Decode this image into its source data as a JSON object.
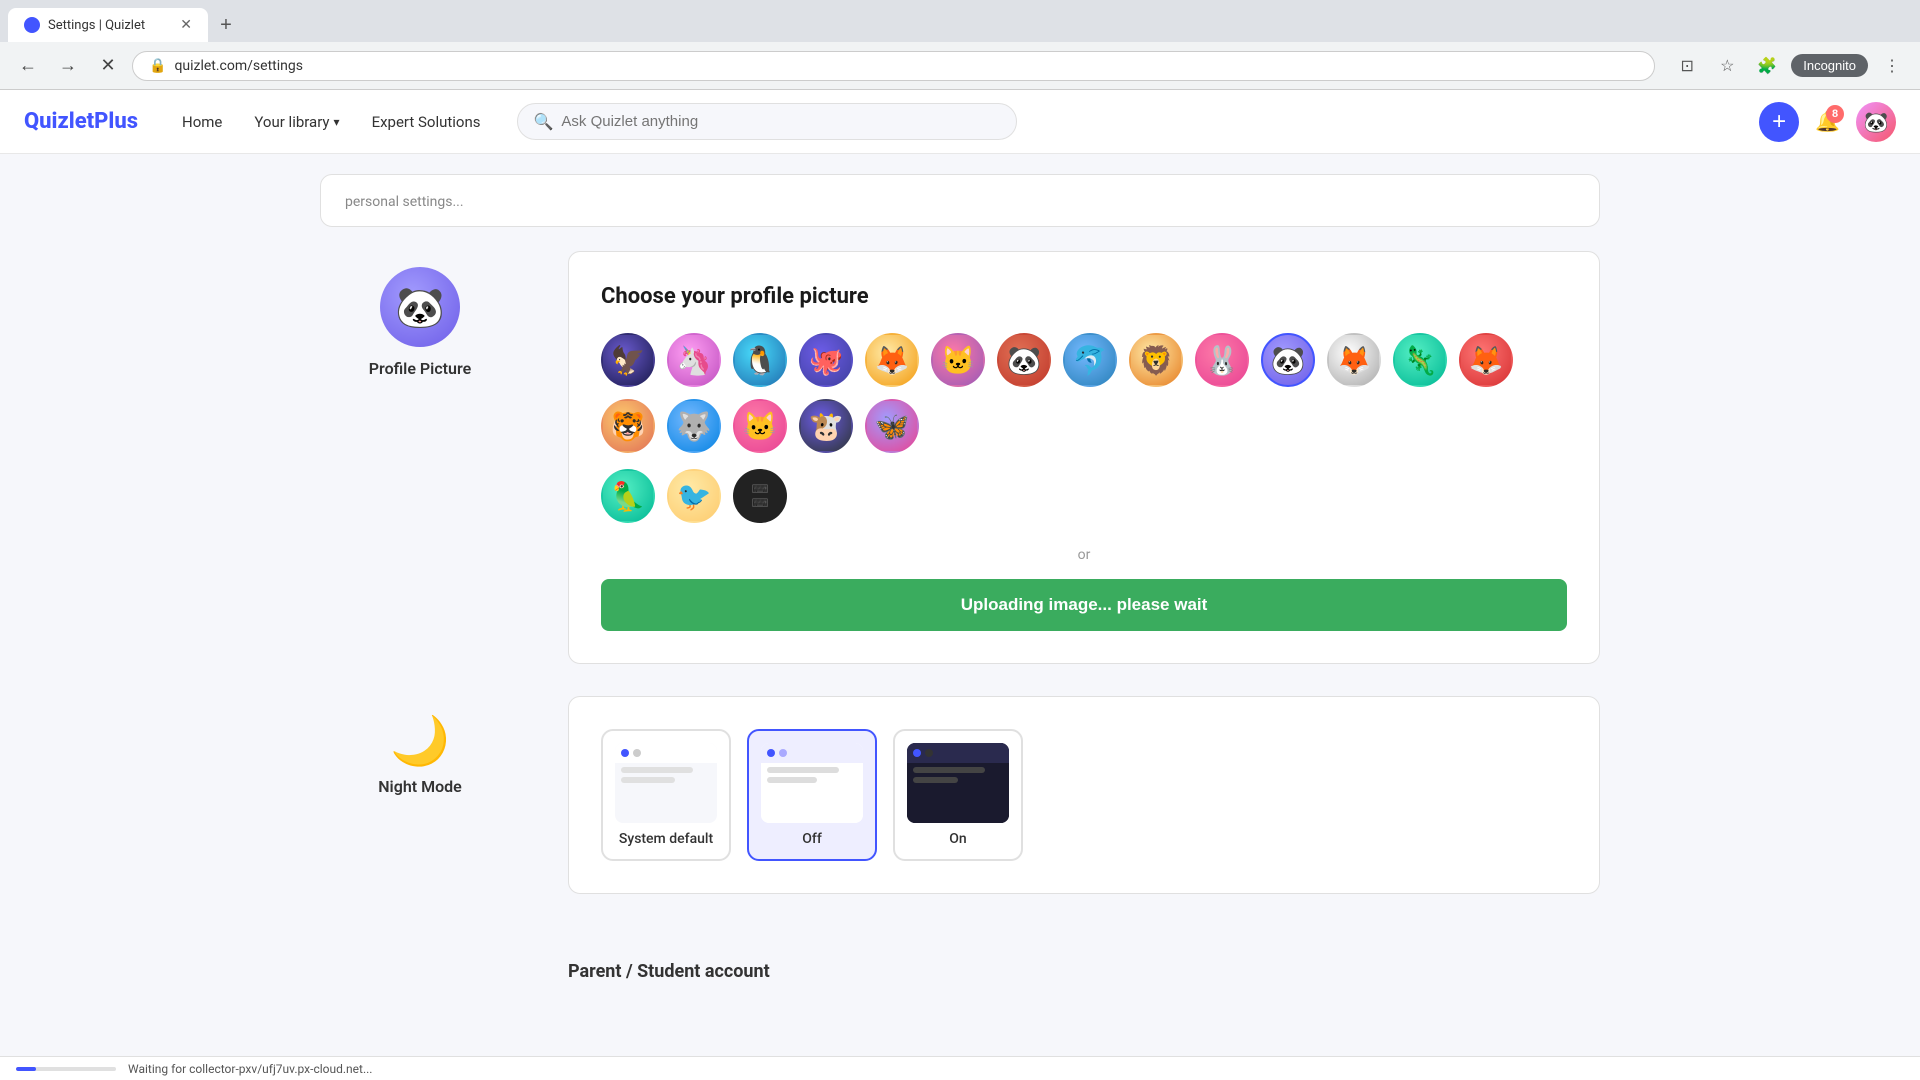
{
  "browser": {
    "tab_title": "Settings | Quizlet",
    "tab_icon": "Q",
    "address": "quizlet.com/settings",
    "new_tab_symbol": "+",
    "incognito_label": "Incognito",
    "notification_badge": "8"
  },
  "nav": {
    "logo": "QuizletPlus",
    "links": [
      {
        "label": "Home",
        "id": "home"
      },
      {
        "label": "Your library",
        "id": "library",
        "has_dropdown": true
      },
      {
        "label": "Expert Solutions",
        "id": "expert"
      }
    ],
    "search_placeholder": "Ask Quizlet anything",
    "add_symbol": "+",
    "bell_badge": "8"
  },
  "profile_picture": {
    "section_title": "Choose your profile picture",
    "label": "Profile Picture",
    "avatars": [
      {
        "id": 1,
        "emoji": "🦅",
        "class": "av1"
      },
      {
        "id": 2,
        "emoji": "🦄",
        "class": "av2"
      },
      {
        "id": 3,
        "emoji": "🐧",
        "class": "av3"
      },
      {
        "id": 4,
        "emoji": "🐙",
        "class": "av4"
      },
      {
        "id": 5,
        "emoji": "🦊",
        "class": "av5"
      },
      {
        "id": 6,
        "emoji": "🐱",
        "class": "av6"
      },
      {
        "id": 7,
        "emoji": "🐼",
        "class": "av7"
      },
      {
        "id": 8,
        "emoji": "🐬",
        "class": "av8"
      },
      {
        "id": 9,
        "emoji": "🦁",
        "class": "av9"
      },
      {
        "id": 10,
        "emoji": "🐰",
        "class": "av10"
      },
      {
        "id": 11,
        "emoji": "🐼",
        "class": "av11"
      },
      {
        "id": 12,
        "emoji": "🦊",
        "class": "av12"
      },
      {
        "id": 13,
        "emoji": "🦎",
        "class": "av13"
      },
      {
        "id": 14,
        "emoji": "🦊",
        "class": "av14"
      },
      {
        "id": 15,
        "emoji": "🐯",
        "class": "av15"
      },
      {
        "id": 16,
        "emoji": "🐺",
        "class": "av16"
      },
      {
        "id": 17,
        "emoji": "🐱",
        "class": "av17"
      },
      {
        "id": 18,
        "emoji": "🐮",
        "class": "av18"
      },
      {
        "id": 19,
        "emoji": "🦋",
        "class": "av19"
      },
      {
        "id": 20,
        "emoji": "🦜",
        "class": "av20"
      },
      {
        "id": 21,
        "emoji": "🐦",
        "class": "av21"
      }
    ],
    "or_text": "or",
    "upload_label": "Uploading image... please wait"
  },
  "night_mode": {
    "label": "Night Mode",
    "icon": "🌙",
    "options": [
      {
        "id": "system",
        "label": "System default",
        "selected": false
      },
      {
        "id": "off",
        "label": "Off",
        "selected": true
      },
      {
        "id": "on",
        "label": "On",
        "selected": false
      }
    ]
  },
  "bottom_section": {
    "partial_title": "Parent / Student account"
  },
  "status_bar": {
    "text": "Waiting for collector-pxv/ufj7uv.px-cloud.net...",
    "progress": 20
  }
}
